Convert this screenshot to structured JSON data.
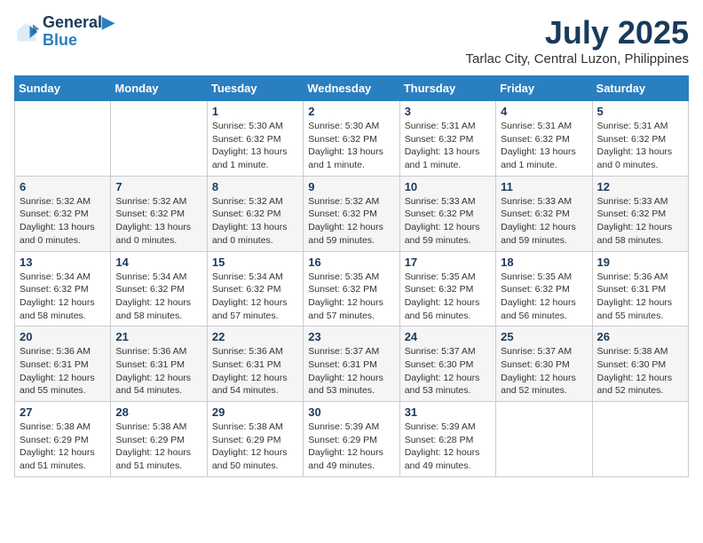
{
  "header": {
    "logo_line1": "General",
    "logo_line2": "Blue",
    "month": "July 2025",
    "location": "Tarlac City, Central Luzon, Philippines"
  },
  "days_of_week": [
    "Sunday",
    "Monday",
    "Tuesday",
    "Wednesday",
    "Thursday",
    "Friday",
    "Saturday"
  ],
  "weeks": [
    [
      {
        "day": "",
        "info": ""
      },
      {
        "day": "",
        "info": ""
      },
      {
        "day": "1",
        "info": "Sunrise: 5:30 AM\nSunset: 6:32 PM\nDaylight: 13 hours and 1 minute."
      },
      {
        "day": "2",
        "info": "Sunrise: 5:30 AM\nSunset: 6:32 PM\nDaylight: 13 hours and 1 minute."
      },
      {
        "day": "3",
        "info": "Sunrise: 5:31 AM\nSunset: 6:32 PM\nDaylight: 13 hours and 1 minute."
      },
      {
        "day": "4",
        "info": "Sunrise: 5:31 AM\nSunset: 6:32 PM\nDaylight: 13 hours and 1 minute."
      },
      {
        "day": "5",
        "info": "Sunrise: 5:31 AM\nSunset: 6:32 PM\nDaylight: 13 hours and 0 minutes."
      }
    ],
    [
      {
        "day": "6",
        "info": "Sunrise: 5:32 AM\nSunset: 6:32 PM\nDaylight: 13 hours and 0 minutes."
      },
      {
        "day": "7",
        "info": "Sunrise: 5:32 AM\nSunset: 6:32 PM\nDaylight: 13 hours and 0 minutes."
      },
      {
        "day": "8",
        "info": "Sunrise: 5:32 AM\nSunset: 6:32 PM\nDaylight: 13 hours and 0 minutes."
      },
      {
        "day": "9",
        "info": "Sunrise: 5:32 AM\nSunset: 6:32 PM\nDaylight: 12 hours and 59 minutes."
      },
      {
        "day": "10",
        "info": "Sunrise: 5:33 AM\nSunset: 6:32 PM\nDaylight: 12 hours and 59 minutes."
      },
      {
        "day": "11",
        "info": "Sunrise: 5:33 AM\nSunset: 6:32 PM\nDaylight: 12 hours and 59 minutes."
      },
      {
        "day": "12",
        "info": "Sunrise: 5:33 AM\nSunset: 6:32 PM\nDaylight: 12 hours and 58 minutes."
      }
    ],
    [
      {
        "day": "13",
        "info": "Sunrise: 5:34 AM\nSunset: 6:32 PM\nDaylight: 12 hours and 58 minutes."
      },
      {
        "day": "14",
        "info": "Sunrise: 5:34 AM\nSunset: 6:32 PM\nDaylight: 12 hours and 58 minutes."
      },
      {
        "day": "15",
        "info": "Sunrise: 5:34 AM\nSunset: 6:32 PM\nDaylight: 12 hours and 57 minutes."
      },
      {
        "day": "16",
        "info": "Sunrise: 5:35 AM\nSunset: 6:32 PM\nDaylight: 12 hours and 57 minutes."
      },
      {
        "day": "17",
        "info": "Sunrise: 5:35 AM\nSunset: 6:32 PM\nDaylight: 12 hours and 56 minutes."
      },
      {
        "day": "18",
        "info": "Sunrise: 5:35 AM\nSunset: 6:32 PM\nDaylight: 12 hours and 56 minutes."
      },
      {
        "day": "19",
        "info": "Sunrise: 5:36 AM\nSunset: 6:31 PM\nDaylight: 12 hours and 55 minutes."
      }
    ],
    [
      {
        "day": "20",
        "info": "Sunrise: 5:36 AM\nSunset: 6:31 PM\nDaylight: 12 hours and 55 minutes."
      },
      {
        "day": "21",
        "info": "Sunrise: 5:36 AM\nSunset: 6:31 PM\nDaylight: 12 hours and 54 minutes."
      },
      {
        "day": "22",
        "info": "Sunrise: 5:36 AM\nSunset: 6:31 PM\nDaylight: 12 hours and 54 minutes."
      },
      {
        "day": "23",
        "info": "Sunrise: 5:37 AM\nSunset: 6:31 PM\nDaylight: 12 hours and 53 minutes."
      },
      {
        "day": "24",
        "info": "Sunrise: 5:37 AM\nSunset: 6:30 PM\nDaylight: 12 hours and 53 minutes."
      },
      {
        "day": "25",
        "info": "Sunrise: 5:37 AM\nSunset: 6:30 PM\nDaylight: 12 hours and 52 minutes."
      },
      {
        "day": "26",
        "info": "Sunrise: 5:38 AM\nSunset: 6:30 PM\nDaylight: 12 hours and 52 minutes."
      }
    ],
    [
      {
        "day": "27",
        "info": "Sunrise: 5:38 AM\nSunset: 6:29 PM\nDaylight: 12 hours and 51 minutes."
      },
      {
        "day": "28",
        "info": "Sunrise: 5:38 AM\nSunset: 6:29 PM\nDaylight: 12 hours and 51 minutes."
      },
      {
        "day": "29",
        "info": "Sunrise: 5:38 AM\nSunset: 6:29 PM\nDaylight: 12 hours and 50 minutes."
      },
      {
        "day": "30",
        "info": "Sunrise: 5:39 AM\nSunset: 6:29 PM\nDaylight: 12 hours and 49 minutes."
      },
      {
        "day": "31",
        "info": "Sunrise: 5:39 AM\nSunset: 6:28 PM\nDaylight: 12 hours and 49 minutes."
      },
      {
        "day": "",
        "info": ""
      },
      {
        "day": "",
        "info": ""
      }
    ]
  ]
}
